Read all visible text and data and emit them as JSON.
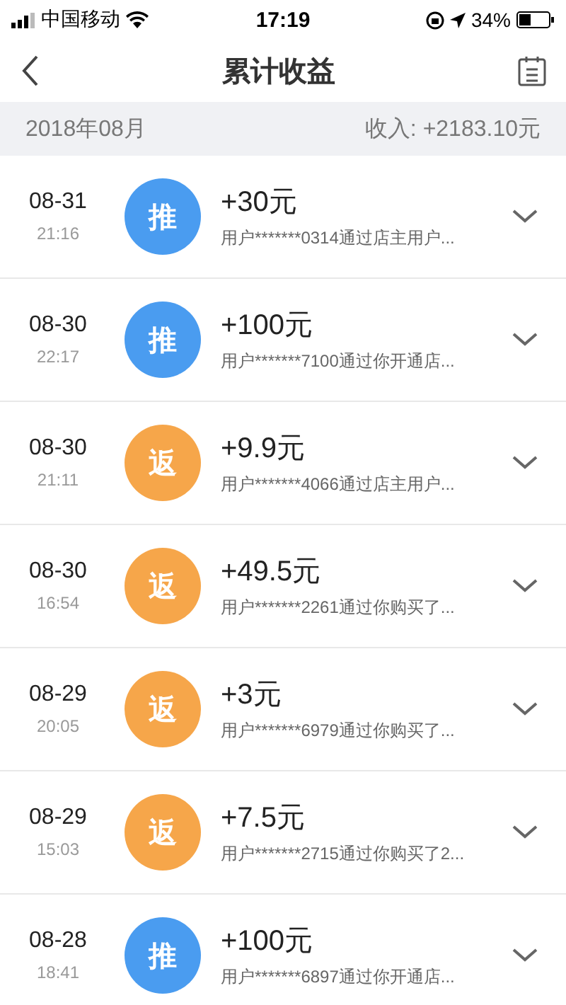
{
  "status_bar": {
    "carrier": "中国移动",
    "time": "17:19",
    "battery": "34%"
  },
  "nav": {
    "title": "累计收益"
  },
  "summary": {
    "month": "2018年08月",
    "income": "收入: +2183.10元"
  },
  "records": [
    {
      "date": "08-31",
      "time": "21:16",
      "kind": "recommend",
      "badge": "推",
      "amount": "+30元",
      "detail": "用户*******0314通过店主用户..."
    },
    {
      "date": "08-30",
      "time": "22:17",
      "kind": "recommend",
      "badge": "推",
      "amount": "+100元",
      "detail": "用户*******7100通过你开通店..."
    },
    {
      "date": "08-30",
      "time": "21:11",
      "kind": "rebate",
      "badge": "返",
      "amount": "+9.9元",
      "detail": "用户*******4066通过店主用户..."
    },
    {
      "date": "08-30",
      "time": "16:54",
      "kind": "rebate",
      "badge": "返",
      "amount": "+49.5元",
      "detail": "用户*******2261通过你购买了..."
    },
    {
      "date": "08-29",
      "time": "20:05",
      "kind": "rebate",
      "badge": "返",
      "amount": "+3元",
      "detail": "用户*******6979通过你购买了..."
    },
    {
      "date": "08-29",
      "time": "15:03",
      "kind": "rebate",
      "badge": "返",
      "amount": "+7.5元",
      "detail": "用户*******2715通过你购买了2..."
    },
    {
      "date": "08-28",
      "time": "18:41",
      "kind": "recommend",
      "badge": "推",
      "amount": "+100元",
      "detail": "用户*******6897通过你开通店..."
    }
  ]
}
